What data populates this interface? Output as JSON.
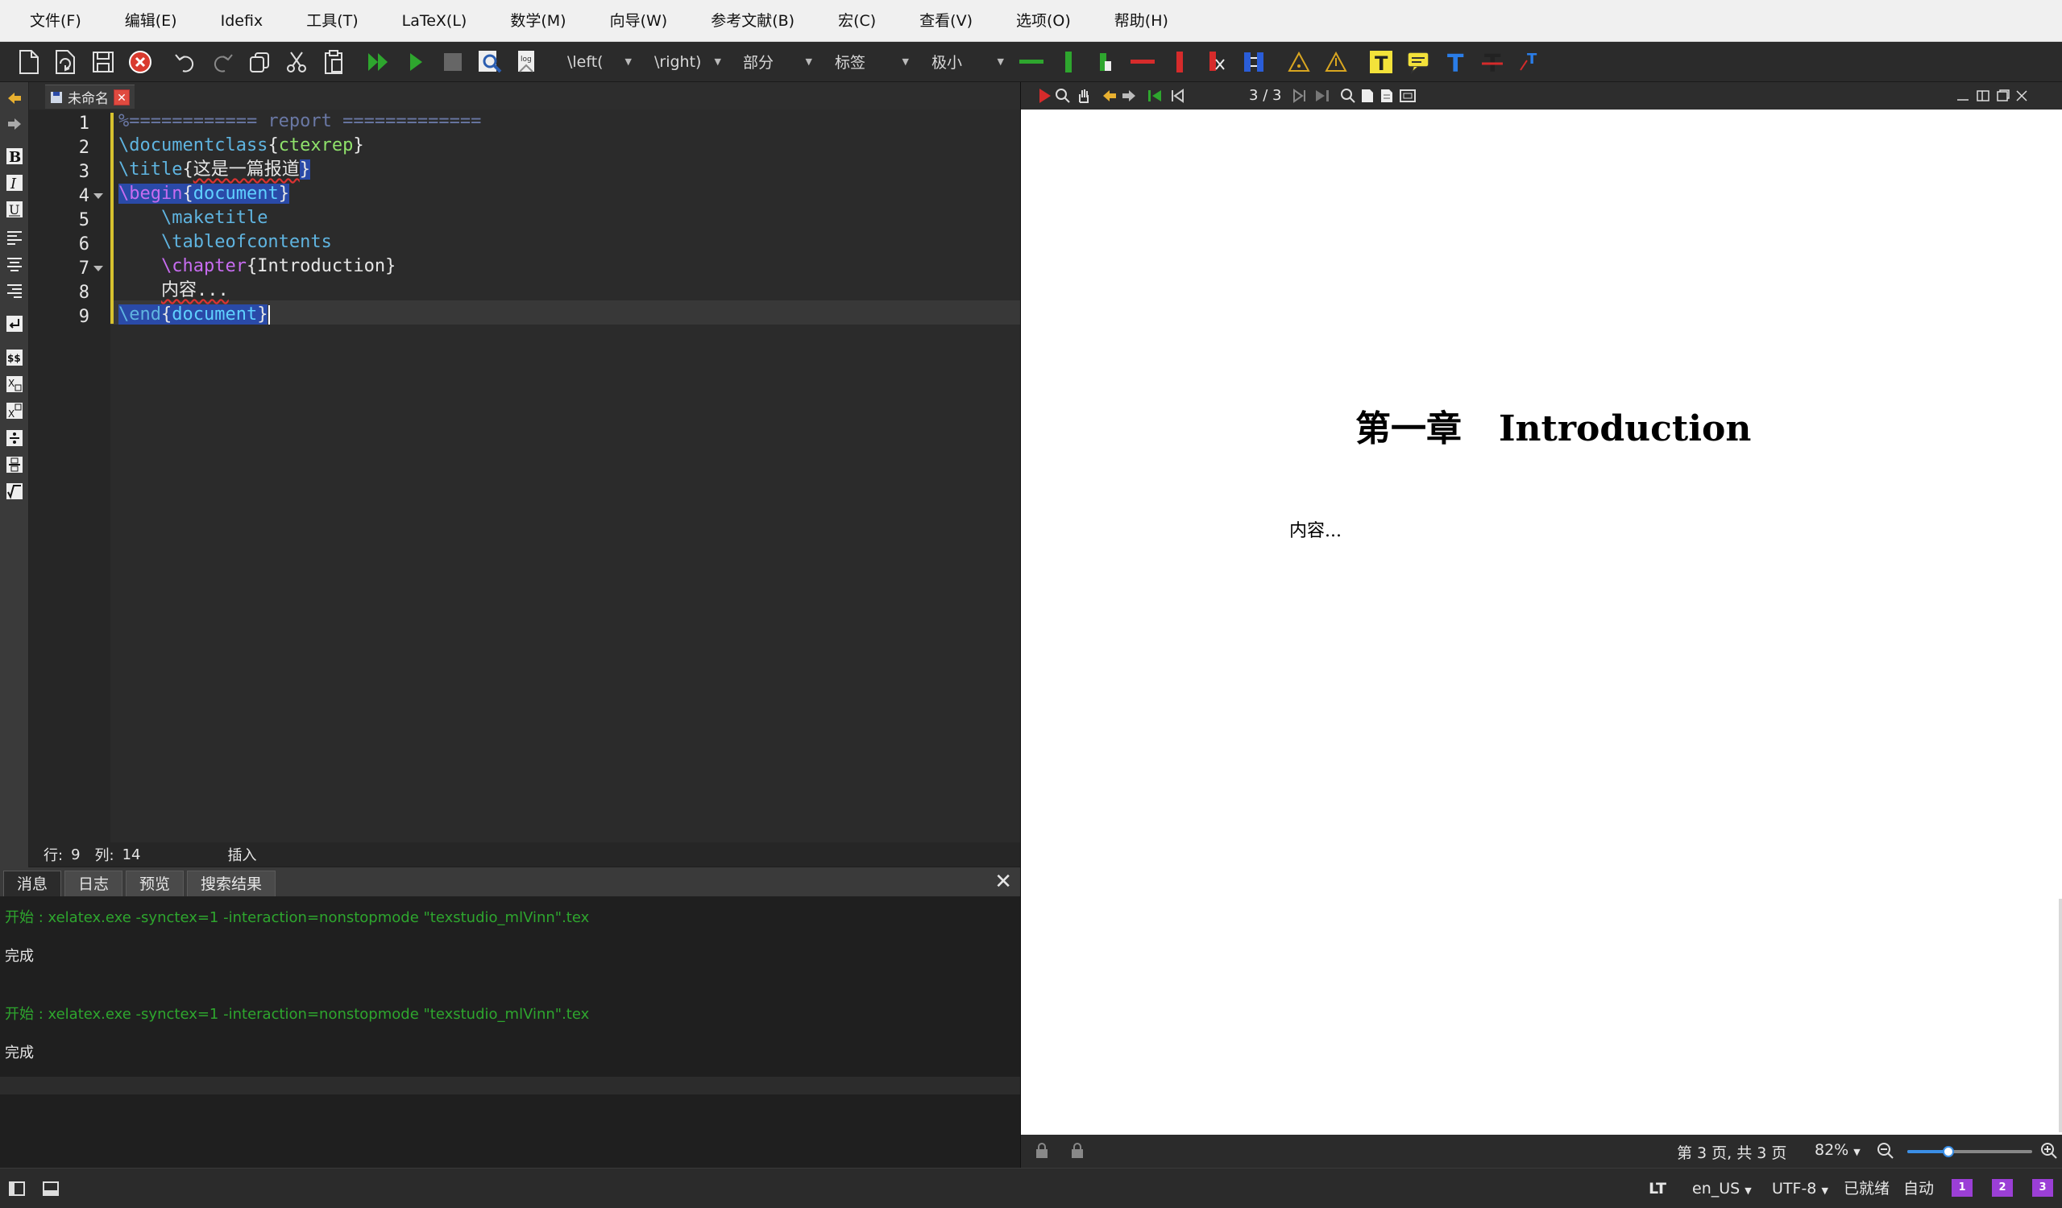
{
  "menu": [
    "文件(F)",
    "编辑(E)",
    "Idefix",
    "工具(T)",
    "LaTeX(L)",
    "数学(M)",
    "向导(W)",
    "参考文献(B)",
    "宏(C)",
    "查看(V)",
    "选项(O)",
    "帮助(H)"
  ],
  "toolbar": {
    "combos": [
      "\\left(",
      "\\right)",
      "部分",
      "标签",
      "极小"
    ]
  },
  "editor": {
    "tab_label": "未命名",
    "line_numbers": [
      "1",
      "2",
      "3",
      "4",
      "5",
      "6",
      "7",
      "8",
      "9"
    ],
    "lines": {
      "l1": "%============ report =============",
      "l2_cmd": "\\documentclass",
      "l2_arg": "ctexrep",
      "l3_cmd": "\\title",
      "l3_arg": "这是一篇报道",
      "l4_cmd": "begin",
      "l4_arg": "document",
      "l5": "\\maketitle",
      "l6": "\\tableofcontents",
      "l7_cmd": "chapter",
      "l7_arg": "Introduction",
      "l8": "内容...",
      "l9_cmd": "end",
      "l9_arg": "document"
    },
    "status": {
      "row_label": "行:",
      "row": "9",
      "col_label": "列:",
      "col": "14",
      "mode": "插入"
    }
  },
  "panel": {
    "tabs": [
      "消息",
      "日志",
      "预览",
      "搜索结果"
    ],
    "messages": [
      "开始 : xelatex.exe -synctex=1 -interaction=nonstopmode \"texstudio_mlVinn\".tex",
      "完成",
      "开始 : xelatex.exe -synctex=1 -interaction=nonstopmode \"texstudio_mlVinn\".tex",
      "完成"
    ]
  },
  "pdf": {
    "page_current": "3",
    "page_total": "3",
    "page_sep": "/",
    "chapter_heading": "第一章   Introduction",
    "body_text": "内容...",
    "page_status": "第 3 页, 共 3 页",
    "zoom": "82%",
    "zoom_fraction": 0.33
  },
  "statusbar": {
    "lt": "LT",
    "language": "en_US",
    "encoding": "UTF-8",
    "ready": "已就绪",
    "auto": "自动",
    "badges": [
      "1",
      "2",
      "3"
    ]
  },
  "colors": {
    "accent": "#3b8fe6",
    "message_green": "#2ea62e",
    "close_red": "#e04a3f"
  }
}
